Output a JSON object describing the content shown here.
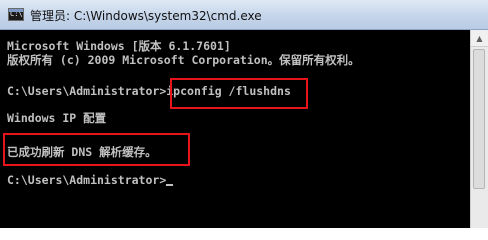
{
  "window": {
    "title": "管理员: C:\\Windows\\system32\\cmd.exe",
    "icon": "cmd-console-icon",
    "icon_glyph": "C:\\"
  },
  "console": {
    "lines": [
      "Microsoft Windows [版本 6.1.7601]",
      "版权所有 (c) 2009 Microsoft Corporation。保留所有权利。",
      "C:\\Users\\Administrator>",
      "Windows IP 配置",
      "已成功刷新 DNS 解析缓存。",
      "C:\\Users\\Administrator>"
    ],
    "command": "ipconfig /flushdns"
  },
  "colors": {
    "console_bg": "#000000",
    "console_text": "#c0c0c0",
    "highlight_box": "#e8141c",
    "titlebar": "#c5d5ea"
  },
  "scrollbar": {
    "up_arrow_icon": "scroll-up-arrow-icon",
    "up_glyph": "▲"
  }
}
